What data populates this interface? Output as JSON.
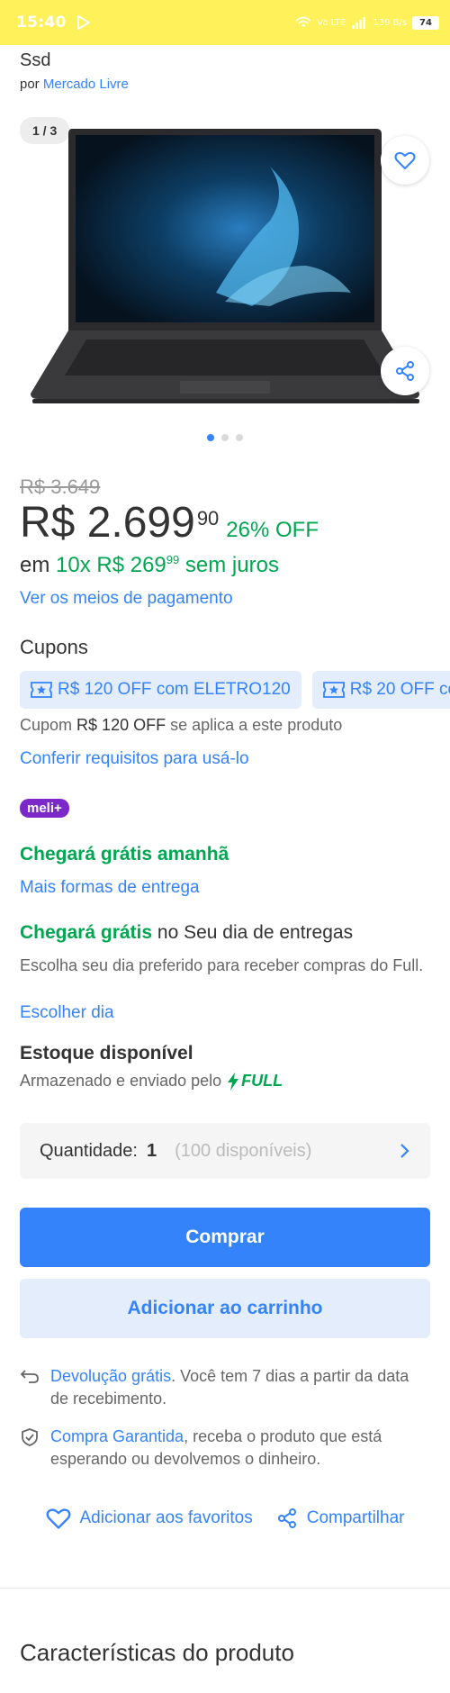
{
  "status_bar": {
    "time": "15:40",
    "network": "Vo LTE",
    "speed": "139 B/s",
    "battery": "74"
  },
  "product": {
    "title_fragment": "Ssd",
    "seller_prefix": "por",
    "seller": "Mercado Livre"
  },
  "gallery": {
    "counter": "1 / 3",
    "dots": 3,
    "active_dot": 0
  },
  "pricing": {
    "old_price": "R$ 3.649",
    "price_main": "R$ 2.699",
    "price_cents": "90",
    "discount": "26% OFF",
    "installment_prefix": "em",
    "installment_plan": "10x R$ 269",
    "installment_cents": "99",
    "installment_suffix": "sem juros",
    "payment_link": "Ver os meios de pagamento"
  },
  "coupons": {
    "title": "Cupons",
    "items": [
      {
        "label": "R$ 120 OFF com ELETRO120"
      },
      {
        "label": "R$ 20 OFF co"
      }
    ],
    "info_prefix": "Cupom",
    "info_amount": "R$ 120 OFF",
    "info_suffix": "se aplica a este produto",
    "requirements_link": "Conferir requisitos para usá-lo"
  },
  "badge": "meli+",
  "shipping": {
    "free_tomorrow": "Chegará grátis amanhã",
    "more_options": "Mais formas de entrega",
    "day_green": "Chegará grátis",
    "day_rest": "no Seu dia de entregas",
    "day_desc": "Escolha seu dia preferido para receber compras do Full.",
    "choose_day": "Escolher dia"
  },
  "stock": {
    "title": "Estoque disponível",
    "desc": "Armazenado e enviado pelo",
    "full_label": "FULL"
  },
  "quantity": {
    "label": "Quantidade:",
    "value": "1",
    "available": "(100 disponíveis)"
  },
  "buttons": {
    "buy": "Comprar",
    "add_cart": "Adicionar ao carrinho"
  },
  "info": {
    "return_link": "Devolução grátis",
    "return_text": ". Você tem 7 dias a partir da data de recebimento.",
    "guarantee_link": "Compra Garantida",
    "guarantee_text": ", receba o produto que está esperando ou devolvemos o dinheiro."
  },
  "actions": {
    "favorite": "Adicionar aos favoritos",
    "share": "Compartilhar"
  },
  "characteristics_title": "Características do produto",
  "colors": {
    "accent": "#3483fa",
    "green": "#00a650",
    "yellow": "#fff159",
    "meli_purple": "#7b29c9"
  },
  "icons": [
    "play-store-icon",
    "wifi-icon",
    "signal-icon",
    "heart-icon",
    "share-icon",
    "coupon-star-icon",
    "chevron-right-icon",
    "bolt-icon",
    "return-arrow-icon",
    "shield-check-icon"
  ]
}
